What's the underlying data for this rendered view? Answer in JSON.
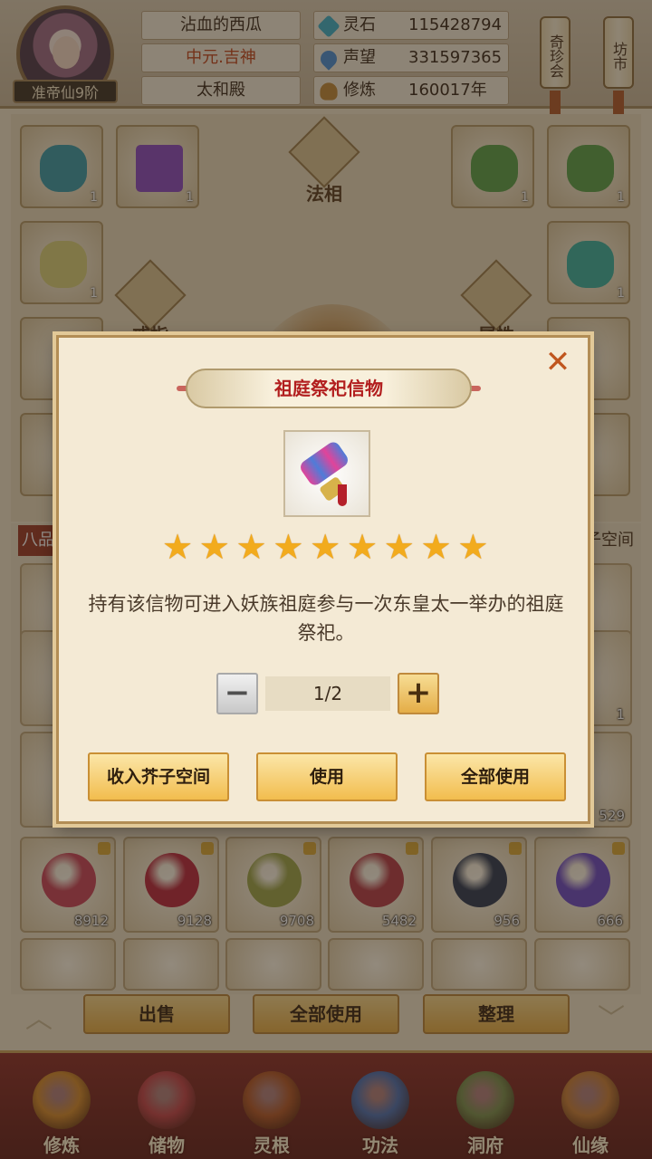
{
  "player": {
    "name": "沾血的西瓜",
    "title": "中元.吉神",
    "location": "太和殿",
    "realm": "准帝仙9阶"
  },
  "resources": [
    {
      "label": "灵石",
      "value": "115428794",
      "icon": "spirit-stone-icon"
    },
    {
      "label": "声望",
      "value": "331597365",
      "icon": "reputation-icon"
    },
    {
      "label": "修炼",
      "value": "160017年",
      "icon": "cultivation-icon"
    }
  ],
  "top_buttons": {
    "treasure": "奇珍会",
    "market": "坊市"
  },
  "equipment": {
    "center_label": "法相",
    "ring_label": "戒指",
    "attr_label": "属性",
    "slot_counts": [
      "1",
      "1",
      "1",
      "1",
      "1",
      "1"
    ]
  },
  "bag": {
    "section_label": "八品",
    "space_label": "子空间",
    "partial_counts": [
      "1",
      "1",
      "529"
    ],
    "items": [
      {
        "count": "8912",
        "color": "#c8455a"
      },
      {
        "count": "9128",
        "color": "#b8283e"
      },
      {
        "count": "9708",
        "color": "#9ca44a"
      },
      {
        "count": "5482",
        "color": "#b43c48"
      },
      {
        "count": "956",
        "color": "#2e3a52"
      },
      {
        "count": "666",
        "color": "#6b4ac4"
      }
    ]
  },
  "bag_actions": {
    "sell": "出售",
    "use_all": "全部使用",
    "sort": "整理"
  },
  "bottom_nav": [
    {
      "label": "修炼",
      "icon": "cultivate-icon",
      "color": "#d48a2e"
    },
    {
      "label": "储物",
      "icon": "storage-bag-icon",
      "color": "#c2444a"
    },
    {
      "label": "灵根",
      "icon": "spirit-root-icon",
      "color": "#b3582a"
    },
    {
      "label": "功法",
      "icon": "technique-book-icon",
      "color": "#4d6fb0"
    },
    {
      "label": "洞府",
      "icon": "cave-mansion-icon",
      "color": "#7b8f4f"
    },
    {
      "label": "仙缘",
      "icon": "immortal-fate-icon",
      "color": "#c97f3a"
    }
  ],
  "dialog": {
    "title": "祖庭祭祀信物",
    "star_count": 9,
    "description": "持有该信物可进入妖族祖庭参与一次东皇太一举办的祖庭祭祀。",
    "quantity": "1/2",
    "buttons": {
      "store": "收入芥子空间",
      "use": "使用",
      "use_all": "全部使用"
    }
  }
}
